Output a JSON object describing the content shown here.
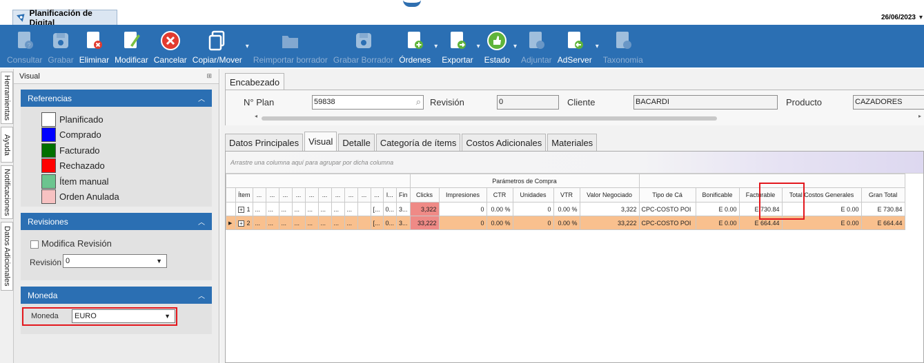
{
  "window": {
    "doc_tab_title": "Planificación de Digital",
    "date": "26/06/2023"
  },
  "ribbon": [
    {
      "label": "Consultar",
      "icon": "doc-question-icon",
      "enabled": false
    },
    {
      "label": "Grabar",
      "icon": "save-icon",
      "enabled": false
    },
    {
      "label": "Eliminar",
      "icon": "doc-delete-icon",
      "enabled": true
    },
    {
      "label": "Modificar",
      "icon": "doc-edit-icon",
      "enabled": true
    },
    {
      "label": "Cancelar",
      "icon": "cancel-icon",
      "enabled": true
    },
    {
      "label": "Copiar/Mover",
      "icon": "copy-icon",
      "enabled": true,
      "dropdown": true
    },
    {
      "label": "Reimportar borrador",
      "icon": "folder-open-icon",
      "enabled": false
    },
    {
      "label": "Grabar Borrador",
      "icon": "save-draft-icon",
      "enabled": false
    },
    {
      "label": "Órdenes",
      "icon": "doc-add-icon",
      "enabled": true,
      "dropdown": true
    },
    {
      "label": "Exportar",
      "icon": "doc-export-icon",
      "enabled": true,
      "dropdown": true
    },
    {
      "label": "Estado",
      "icon": "thumbs-up-icon",
      "enabled": true,
      "dropdown": true
    },
    {
      "label": "Adjuntar",
      "icon": "doc-attach-icon",
      "enabled": false
    },
    {
      "label": "AdServer",
      "icon": "doc-import-icon",
      "enabled": true,
      "dropdown": true
    },
    {
      "label": "Taxonomia",
      "icon": "doc-tag-icon",
      "enabled": false
    }
  ],
  "side_tabs": [
    "Herramientas",
    "Ayuda",
    "Notificaciones",
    "Datos Adicionales"
  ],
  "left_panel": {
    "title": "Visual",
    "referencias": {
      "header": "Referencias",
      "items": [
        {
          "label": "Planificado",
          "color": "#ffffff"
        },
        {
          "label": "Comprado",
          "color": "#0000ff"
        },
        {
          "label": "Facturado",
          "color": "#007000"
        },
        {
          "label": "Rechazado",
          "color": "#ff0000"
        },
        {
          "label": "Ítem manual",
          "color": "#6cc48f"
        },
        {
          "label": "Orden Anulada",
          "color": "#f7c2c2"
        }
      ]
    },
    "revisiones": {
      "header": "Revisiones",
      "modifica_label": "Modifica Revisión",
      "revision_label": "Revisión",
      "revision_value": "0"
    },
    "moneda": {
      "header": "Moneda",
      "label": "Moneda",
      "value": "EURO"
    }
  },
  "encabezado": {
    "tab": "Encabezado",
    "nplan_label": "N° Plan",
    "nplan_value": "59838",
    "revision_label": "Revisión",
    "revision_value": "0",
    "cliente_label": "Cliente",
    "cliente_value": "BACARDI",
    "producto_label": "Producto",
    "producto_value": "CAZADORES"
  },
  "tabs": [
    "Datos Principales",
    "Visual",
    "Detalle",
    "Categoría de ítems",
    "Costos Adicionales",
    "Materiales"
  ],
  "active_tab": "Visual",
  "grid": {
    "group_hint": "Arrastre una columna aquí para agrupar por dicha columna",
    "group_header": "Parámetros de Compra",
    "columns": [
      "Ítem",
      "...",
      "...",
      "...",
      "...",
      "...",
      "...",
      "...",
      "...",
      "...",
      "...",
      "I...",
      "Fin",
      "Clicks",
      "Impresiones",
      "CTR",
      "Unidades",
      "VTR",
      "Valor Negociado",
      "Tipo de Cá",
      "Bonificable",
      "Facturable",
      "Total Costos Generales",
      "Gran Total"
    ],
    "rows": [
      {
        "item": "1",
        "dots": [
          "...",
          "...",
          "...",
          "...",
          "...",
          "...",
          "...",
          "...",
          ""
        ],
        "i": "[...",
        "i2": "0...",
        "fin": "3...",
        "clicks": "3,322",
        "impresiones": "0",
        "ctr": "0.00 %",
        "unidades": "0",
        "vtr": "0.00 %",
        "valor": "3,322",
        "tipo": "CPC-COSTO POI",
        "bonificable": "E 0.00",
        "facturable": "E 730.84",
        "total_costos": "E 0.00",
        "gran_total": "E 730.84"
      },
      {
        "item": "2",
        "dots": [
          "...",
          "...",
          "...",
          "...",
          "...",
          "...",
          "...",
          "...",
          ""
        ],
        "i": "[...",
        "i2": "0...",
        "fin": "3...",
        "clicks": "33,222",
        "impresiones": "0",
        "ctr": "0.00 %",
        "unidades": "0",
        "vtr": "0.00 %",
        "valor": "33,222",
        "tipo": "CPC-COSTO POI",
        "bonificable": "E 0.00",
        "facturable": "E 664.44",
        "total_costos": "E 0.00",
        "gran_total": "E 664.44"
      }
    ]
  }
}
